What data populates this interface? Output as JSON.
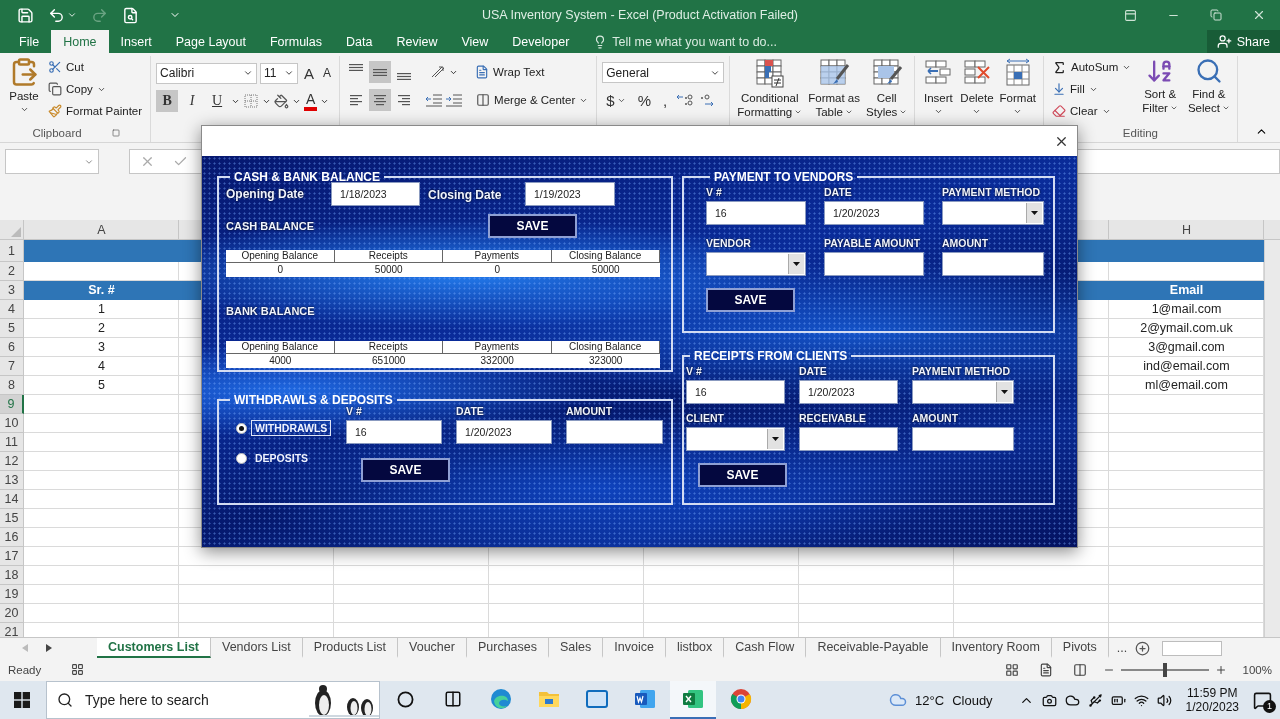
{
  "title_bar": {
    "title": "USA Inventory System - Excel (Product Activation Failed)"
  },
  "ribbon_tabs": [
    {
      "label": "File",
      "selected": false
    },
    {
      "label": "Home",
      "selected": true
    },
    {
      "label": "Insert",
      "selected": false
    },
    {
      "label": "Page Layout",
      "selected": false
    },
    {
      "label": "Formulas",
      "selected": false
    },
    {
      "label": "Data",
      "selected": false
    },
    {
      "label": "Review",
      "selected": false
    },
    {
      "label": "View",
      "selected": false
    },
    {
      "label": "Developer",
      "selected": false
    }
  ],
  "tell_me": {
    "placeholder": "Tell me what you want to do..."
  },
  "share": "Share",
  "clipboard": {
    "paste": "Paste",
    "cut": "Cut",
    "copy": "Copy",
    "format_painter": "Format Painter",
    "label": "Clipboard"
  },
  "font": {
    "name": "Calibri",
    "size": "11",
    "grow": "A",
    "shrink": "A",
    "color_letter": "A",
    "styles": [
      {
        "label": "B",
        "selected": true
      },
      {
        "label": "I",
        "selected": false
      },
      {
        "label": "U",
        "selected": false
      }
    ]
  },
  "alignment": {
    "vertical": [
      {
        "selected": false
      },
      {
        "selected": true
      },
      {
        "selected": false
      }
    ],
    "horizontal": [
      {
        "selected": false
      },
      {
        "selected": true
      },
      {
        "selected": false
      }
    ],
    "wrap_text": "Wrap Text",
    "merge_center": "Merge & Center"
  },
  "number": {
    "format": "General",
    "currency": "$",
    "percent": "%",
    "comma": ","
  },
  "styles": [
    {
      "kind": "conditional",
      "lines": [
        "Conditional",
        "Formatting"
      ]
    },
    {
      "kind": "table",
      "lines": [
        "Format as",
        "Table"
      ]
    },
    {
      "kind": "cell",
      "lines": [
        "Cell",
        "Styles"
      ]
    }
  ],
  "cells": [
    {
      "kind": "insert",
      "label": "Insert"
    },
    {
      "kind": "delete",
      "label": "Delete"
    },
    {
      "kind": "format",
      "label": "Format"
    }
  ],
  "editing": {
    "autosum": "AutoSum",
    "fill": "Fill",
    "clear": "Clear",
    "sort": [
      "Sort &",
      "Filter"
    ],
    "find": [
      "Find &",
      "Select"
    ],
    "label": "Editing"
  },
  "sheet": {
    "columns": [
      "A",
      "H"
    ],
    "rows": [
      {
        "number": "1",
        "kind": "band",
        "selected": false
      },
      {
        "number": "2",
        "kind": "plain",
        "selected": false
      },
      {
        "number": "3",
        "kind": "header",
        "selected": false,
        "a": "Sr. #",
        "h": "Email"
      },
      {
        "number": "4",
        "kind": "plain",
        "selected": false,
        "a": "1",
        "h": "1@mail.com"
      },
      {
        "number": "5",
        "kind": "plain",
        "selected": false,
        "a": "2",
        "h": "2@ymail.com.uk"
      },
      {
        "number": "6",
        "kind": "plain",
        "selected": false,
        "a": "3",
        "h": "3@gmail.com"
      },
      {
        "number": "7",
        "kind": "plain",
        "selected": false,
        "a": "4",
        "h": "ind@email.com"
      },
      {
        "number": "8",
        "kind": "plain",
        "selected": false,
        "a": "5",
        "h": "ml@email.com"
      },
      {
        "number": "9",
        "kind": "plain",
        "selected": true
      },
      {
        "number": "10",
        "kind": "plain",
        "selected": false
      },
      {
        "number": "11",
        "kind": "plain",
        "selected": false
      },
      {
        "number": "12",
        "kind": "plain",
        "selected": false
      },
      {
        "number": "13",
        "kind": "plain",
        "selected": false
      },
      {
        "number": "14",
        "kind": "plain",
        "selected": false
      },
      {
        "number": "15",
        "kind": "plain",
        "selected": false
      },
      {
        "number": "16",
        "kind": "plain",
        "selected": false
      },
      {
        "number": "17",
        "kind": "plain",
        "selected": false
      },
      {
        "number": "18",
        "kind": "plain",
        "selected": false
      },
      {
        "number": "19",
        "kind": "plain",
        "selected": false
      },
      {
        "number": "20",
        "kind": "plain",
        "selected": false
      },
      {
        "number": "21",
        "kind": "plain",
        "selected": false
      }
    ]
  },
  "sheet_tabs": [
    {
      "label": "Customers List",
      "selected": true
    },
    {
      "label": "Vendors List",
      "selected": false
    },
    {
      "label": "Products List",
      "selected": false
    },
    {
      "label": "Voucher",
      "selected": false
    },
    {
      "label": "Purchases",
      "selected": false
    },
    {
      "label": "Sales",
      "selected": false
    },
    {
      "label": "Invoice",
      "selected": false
    },
    {
      "label": "listbox",
      "selected": false
    },
    {
      "label": "Cash Flow",
      "selected": false
    },
    {
      "label": "Receivable-Payable",
      "selected": false
    },
    {
      "label": "Inventory Room",
      "selected": false
    },
    {
      "label": "Pivots",
      "selected": false
    }
  ],
  "more_tabs": "...",
  "status_bar": {
    "status": "Ready",
    "zoom": {
      "level": 0.5,
      "reading": "100%"
    }
  },
  "dialog": {
    "cash_bank": {
      "title": "CASH & BANK BALANCE",
      "opening_label": "Opening Date",
      "opening": "1/18/2023",
      "closing_label": "Closing Date",
      "closing": "1/19/2023",
      "save": "SAVE",
      "tables": [
        {
          "title": "CASH BALANCE",
          "columns": [
            "Opening Balance",
            "Receipts",
            "Payments",
            "Closing Balance"
          ],
          "values": [
            "0",
            "50000",
            "0",
            "50000"
          ]
        },
        {
          "title": "BANK BALANCE",
          "columns": [
            "Opening Balance",
            "Receipts",
            "Payments",
            "Closing Balance"
          ],
          "values": [
            "4000",
            "651000",
            "332000",
            "323000"
          ]
        }
      ]
    },
    "withdrawals": {
      "title": "WITHDRAWLS & DEPOSITS",
      "options": [
        {
          "label": "WITHDRAWLS",
          "selected": true
        },
        {
          "label": "DEPOSITS",
          "selected": false
        }
      ],
      "fields": [
        {
          "label": "V #",
          "kind": "text",
          "value": "16"
        },
        {
          "label": "DATE",
          "kind": "text",
          "value": "1/20/2023"
        },
        {
          "label": "AMOUNT",
          "kind": "text"
        }
      ],
      "save": "SAVE"
    },
    "vendors": {
      "title": "PAYMENT TO VENDORS",
      "fields": [
        {
          "label": "V #",
          "kind": "text",
          "value": "16"
        },
        {
          "label": "DATE",
          "kind": "text",
          "value": "1/20/2023"
        },
        {
          "label": "PAYMENT METHOD",
          "kind": "dropdown"
        },
        {
          "label": "VENDOR",
          "kind": "dropdown"
        },
        {
          "label": "PAYABLE AMOUNT",
          "kind": "text"
        },
        {
          "label": "AMOUNT",
          "kind": "text"
        }
      ],
      "save": "SAVE"
    },
    "receipts": {
      "title": "RECEIPTS FROM CLIENTS",
      "fields": [
        {
          "label": "V #",
          "kind": "text",
          "value": "16"
        },
        {
          "label": "DATE",
          "kind": "text",
          "value": "1/20/2023"
        },
        {
          "label": "PAYMENT METHOD",
          "kind": "dropdown"
        },
        {
          "label": "CLIENT",
          "kind": "dropdown"
        },
        {
          "label": "RECEIVABLE",
          "kind": "text"
        },
        {
          "label": "AMOUNT",
          "kind": "text"
        }
      ],
      "save": "SAVE"
    }
  },
  "taskbar": {
    "search_placeholder": "Type here to search",
    "apps": [
      {
        "kind": "edge",
        "active": false
      },
      {
        "kind": "files",
        "active": false
      },
      {
        "kind": "mail",
        "active": false
      },
      {
        "kind": "word",
        "active": false
      },
      {
        "kind": "excel",
        "active": true
      },
      {
        "kind": "chrome",
        "active": false
      }
    ],
    "temperature": "12°C",
    "condition": "Cloudy",
    "time": "11:59 PM",
    "date": "1/20/2023",
    "notifications": "1"
  }
}
